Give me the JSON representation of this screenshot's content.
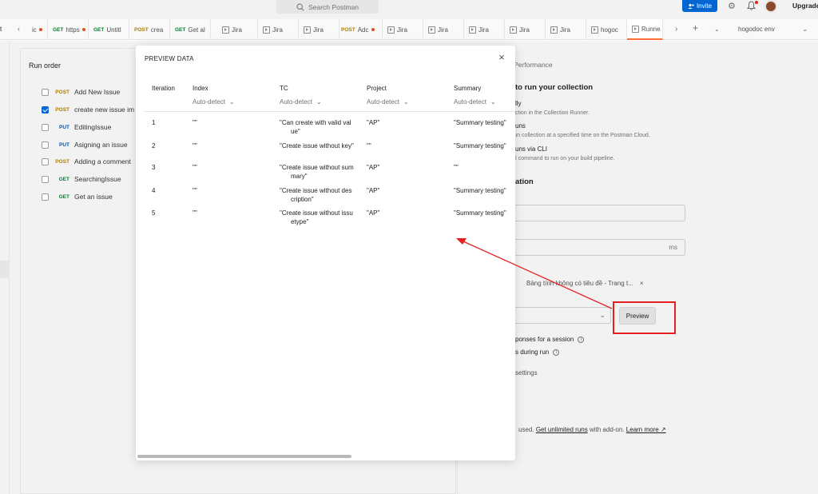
{
  "topbar": {
    "search_placeholder": "Search Postman",
    "invite_label": "Invite",
    "upgrade_label": "Upgrade"
  },
  "tabs": {
    "edge_text": "t",
    "items": [
      {
        "method": "",
        "label": "ic",
        "dot": true
      },
      {
        "method": "GET",
        "label": "https",
        "dot": true
      },
      {
        "method": "GET",
        "label": "Untitl",
        "dot": false
      },
      {
        "method": "POST",
        "label": "crea",
        "dot": false
      },
      {
        "method": "GET",
        "label": "Get al",
        "dot": false
      },
      {
        "method": "",
        "label": "Jira",
        "dot": false
      },
      {
        "method": "",
        "label": "Jira",
        "dot": false
      },
      {
        "method": "",
        "label": "Jira",
        "dot": false
      },
      {
        "method": "POST",
        "label": "Adc",
        "dot": true
      },
      {
        "method": "",
        "label": "Jira",
        "dot": false
      },
      {
        "method": "",
        "label": "Jira",
        "dot": false
      },
      {
        "method": "",
        "label": "Jira",
        "dot": false
      },
      {
        "method": "",
        "label": "Jira",
        "dot": false
      },
      {
        "method": "",
        "label": "Jira",
        "dot": false
      },
      {
        "method": "",
        "label": "hogoc",
        "dot": false
      },
      {
        "method": "",
        "label": "Runne",
        "dot": false
      }
    ],
    "environment": "hogodoc env"
  },
  "run_order": {
    "title": "Run order",
    "requests": [
      {
        "method": "POST",
        "name": "Add New Issue",
        "checked": false
      },
      {
        "method": "POST",
        "name": "create new issue im",
        "checked": true
      },
      {
        "method": "PUT",
        "name": "EditingIssue",
        "checked": false
      },
      {
        "method": "PUT",
        "name": "Asigning an issue",
        "checked": false
      },
      {
        "method": "POST",
        "name": "Adding a comment",
        "checked": false
      },
      {
        "method": "GET",
        "name": "SearchingIssue",
        "checked": false
      },
      {
        "method": "GET",
        "name": "Get an issue",
        "checked": false
      }
    ]
  },
  "right_panel": {
    "tab_performance": "Performance",
    "choose_heading": "to run your collection",
    "opt1_title": "lly",
    "opt1_desc": "ection in the Collection Runner.",
    "opt2_title": "uns",
    "opt2_desc": "run collection at a specified time on the Postman Cloud.",
    "opt3_title": "uns via CLI",
    "opt3_desc": "LI command to run on your build pipeline.",
    "config_heading": "ation",
    "delay_unit": "ms",
    "file_name": "Bảng tính không có tiêu đề - Trang t...",
    "file_remove": "×",
    "preview_label": "Preview",
    "persist_label": "ponses for a session",
    "turnoff_label": "s during run",
    "advanced_label": "settings",
    "usage_prefix": "used.",
    "usage_link1": "Get unlimited runs",
    "usage_mid": "with add-on.",
    "usage_link2": "Learn more ↗"
  },
  "modal": {
    "title": "PREVIEW DATA",
    "columns": [
      {
        "name": "Iteration",
        "type": ""
      },
      {
        "name": "Index",
        "type": "Auto-detect"
      },
      {
        "name": "TC",
        "type": "Auto-detect"
      },
      {
        "name": "Project",
        "type": "Auto-detect"
      },
      {
        "name": "Summary",
        "type": "Auto-detect"
      }
    ],
    "rows": [
      {
        "iteration": "1",
        "index": "\"\"",
        "tc1": "\"Can create with valid val",
        "tc2": "ue\"",
        "project": "\"AP\"",
        "summary": "\"Summary testing\""
      },
      {
        "iteration": "2",
        "index": "\"\"",
        "tc1": "\"Create issue without key\"",
        "tc2": "",
        "project": "\"\"",
        "summary": "\"Summary testing\""
      },
      {
        "iteration": "3",
        "index": "\"\"",
        "tc1": "\"Create issue without sum",
        "tc2": "mary\"",
        "project": "\"AP\"",
        "summary": "\"\""
      },
      {
        "iteration": "4",
        "index": "\"\"",
        "tc1": "\"Create issue without des",
        "tc2": "cription\"",
        "project": "\"AP\"",
        "summary": "\"Summary testing\""
      },
      {
        "iteration": "5",
        "index": "\"\"",
        "tc1": "\"Create issue without issu",
        "tc2": "etype\"",
        "project": "\"AP\"",
        "summary": "\"Summary testing\""
      }
    ]
  },
  "colors": {
    "accent_blue": "#0265d2",
    "annotation_red": "#e51f1f",
    "get": "#007f31",
    "post": "#ad7a03",
    "put": "#0053b8"
  }
}
